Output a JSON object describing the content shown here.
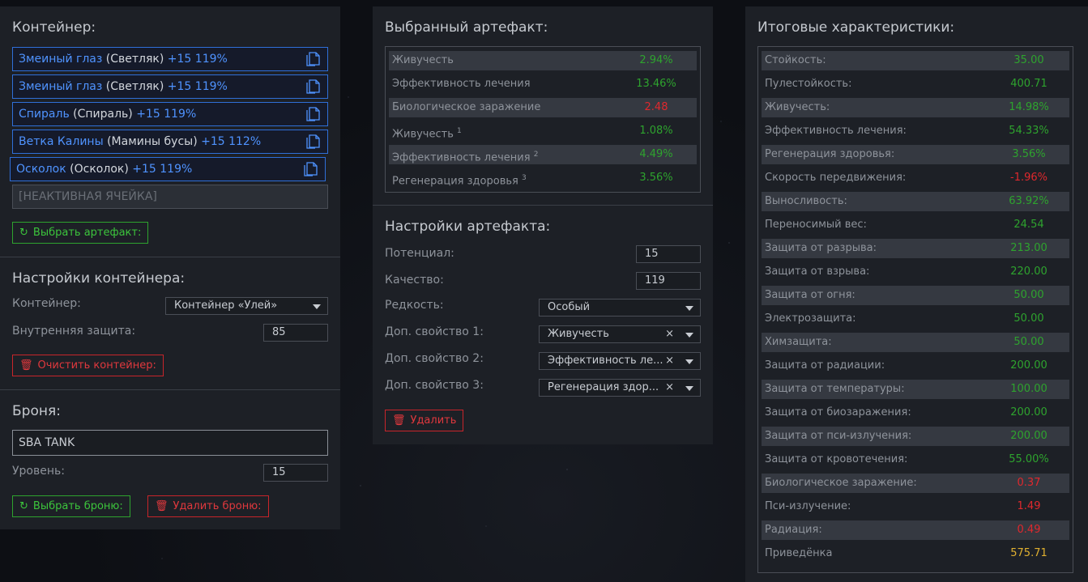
{
  "container_panel": {
    "title": "Контейнер:",
    "slots": [
      {
        "name": "Змеиный глаз",
        "sub": "(Светляк)",
        "level": "+15 119%"
      },
      {
        "name": "Змеиный глаз",
        "sub": "(Светляк)",
        "level": "+15 119%"
      },
      {
        "name": "Спираль",
        "sub": "(Спираль)",
        "level": "+15 119%"
      },
      {
        "name": "Ветка Калины",
        "sub": "(Мамины бусы)",
        "level": "+15 112%"
      },
      {
        "name": "Осколок",
        "sub": "(Осколок)",
        "level": "+15 119%"
      }
    ],
    "inactive_slot": "[НЕАКТИВНАЯ ЯЧЕЙКА]",
    "select_artifact_btn": "Выбрать артефакт:",
    "settings_title": "Настройки контейнера:",
    "container_label": "Контейнер:",
    "container_value": "Контейнер «Улей»",
    "protection_label": "Внутренняя защита:",
    "protection_value": "85",
    "clear_btn": "Очистить контейнер:"
  },
  "armor_panel": {
    "title": "Броня:",
    "armor_value": "SBA TANK",
    "level_label": "Уровень:",
    "level_value": "15",
    "select_btn": "Выбрать броню:",
    "delete_btn": "Удалить броню:"
  },
  "artifact_panel": {
    "title": "Выбранный артефакт:",
    "stats": [
      {
        "name": "Живучесть",
        "sup": "",
        "value": "2.94%",
        "color": "pos"
      },
      {
        "name": "Эффективность лечения",
        "sup": "",
        "value": "13.46%",
        "color": "pos"
      },
      {
        "name": "Биологическое заражение",
        "sup": "",
        "value": "2.48",
        "color": "neg"
      },
      {
        "name": "Живучесть",
        "sup": "1",
        "value": "1.08%",
        "color": "pos"
      },
      {
        "name": "Эффективность лечения",
        "sup": "2",
        "value": "4.49%",
        "color": "pos"
      },
      {
        "name": "Регенерация здоровья",
        "sup": "3",
        "value": "3.56%",
        "color": "pos"
      }
    ],
    "settings_title": "Настройки артефакта:",
    "potential_label": "Потенциал:",
    "potential_value": "15",
    "quality_label": "Качество:",
    "quality_value": "119",
    "rarity_label": "Редкость:",
    "rarity_value": "Особый",
    "prop1_label": "Доп. свойство 1:",
    "prop1_value": "Живучесть",
    "prop2_label": "Доп. свойство 2:",
    "prop2_value": "Эффективность ле...",
    "prop3_label": "Доп. свойство 3:",
    "prop3_value": "Регенерация здор...",
    "clear_x": "×",
    "delete_btn": "Удалить"
  },
  "totals_panel": {
    "title": "Итоговые характеристики:",
    "stats": [
      {
        "name": "Стойкость:",
        "value": "35.00",
        "color": "pos"
      },
      {
        "name": "Пулестойкость:",
        "value": "400.71",
        "color": "pos"
      },
      {
        "name": "Живучесть:",
        "value": "14.98%",
        "color": "pos"
      },
      {
        "name": "Эффективность лечения:",
        "value": "54.33%",
        "color": "pos"
      },
      {
        "name": "Регенерация здоровья:",
        "value": "3.56%",
        "color": "pos"
      },
      {
        "name": "Скорость передвижения:",
        "value": "-1.96%",
        "color": "neg"
      },
      {
        "name": "Выносливость:",
        "value": "63.92%",
        "color": "pos"
      },
      {
        "name": "Переносимый вес:",
        "value": "24.54",
        "color": "pos"
      },
      {
        "name": "Защита от разрыва:",
        "value": "213.00",
        "color": "pos"
      },
      {
        "name": "Защита от взрыва:",
        "value": "220.00",
        "color": "pos"
      },
      {
        "name": "Защита от огня:",
        "value": "50.00",
        "color": "pos"
      },
      {
        "name": "Электрозащита:",
        "value": "50.00",
        "color": "pos"
      },
      {
        "name": "Химзащита:",
        "value": "50.00",
        "color": "pos"
      },
      {
        "name": "Защита от радиации:",
        "value": "200.00",
        "color": "pos"
      },
      {
        "name": "Защита от температуры:",
        "value": "100.00",
        "color": "pos"
      },
      {
        "name": "Защита от биозаражения:",
        "value": "200.00",
        "color": "pos"
      },
      {
        "name": "Защита от пси-излучения:",
        "value": "200.00",
        "color": "pos"
      },
      {
        "name": "Защита от кровотечения:",
        "value": "55.00%",
        "color": "pos"
      },
      {
        "name": "Биологическое заражение:",
        "value": "0.37",
        "color": "neg"
      },
      {
        "name": "Пси-излучение:",
        "value": "1.49",
        "color": "neg"
      },
      {
        "name": "Радиация:",
        "value": "0.49",
        "color": "neg"
      },
      {
        "name": "Приведёнка",
        "value": "575.71",
        "color": "gold"
      }
    ]
  },
  "icons": {
    "copy": "copy-icon",
    "refresh": "refresh-icon",
    "trash": "trash-icon",
    "chevron": "chevron-down-icon"
  },
  "colors": {
    "slot_border": "#2f6fd8",
    "slot_name": "#4f93ff",
    "positive": "#2ea32e",
    "negative": "#e0282d",
    "gold": "#e0b030"
  }
}
